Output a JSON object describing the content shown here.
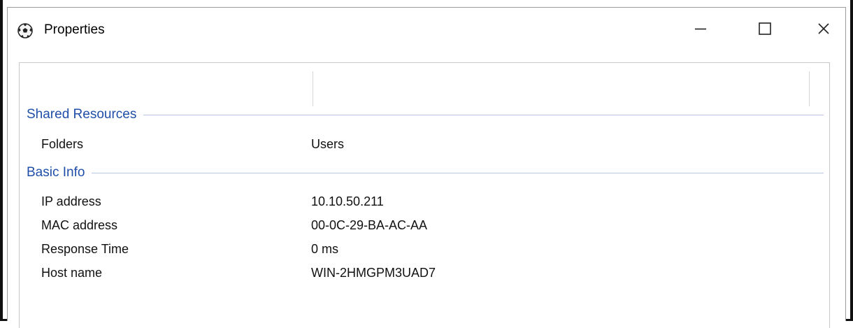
{
  "window": {
    "title": "Properties",
    "app_icon": "soccer-ball-icon",
    "controls": {
      "minimize": "minimize-icon",
      "maximize": "maximize-icon",
      "close": "close-icon"
    }
  },
  "sections": [
    {
      "title": "Shared Resources",
      "rows": [
        {
          "label": "Folders",
          "value": "Users"
        }
      ]
    },
    {
      "title": "Basic Info",
      "rows": [
        {
          "label": "IP address",
          "value": "10.10.50.211"
        },
        {
          "label": "MAC address",
          "value": "00-0C-29-BA-AC-AA"
        },
        {
          "label": "Response Time",
          "value": "0 ms"
        },
        {
          "label": "Host name",
          "value": "WIN-2HMGPM3UAD7"
        }
      ]
    }
  ]
}
